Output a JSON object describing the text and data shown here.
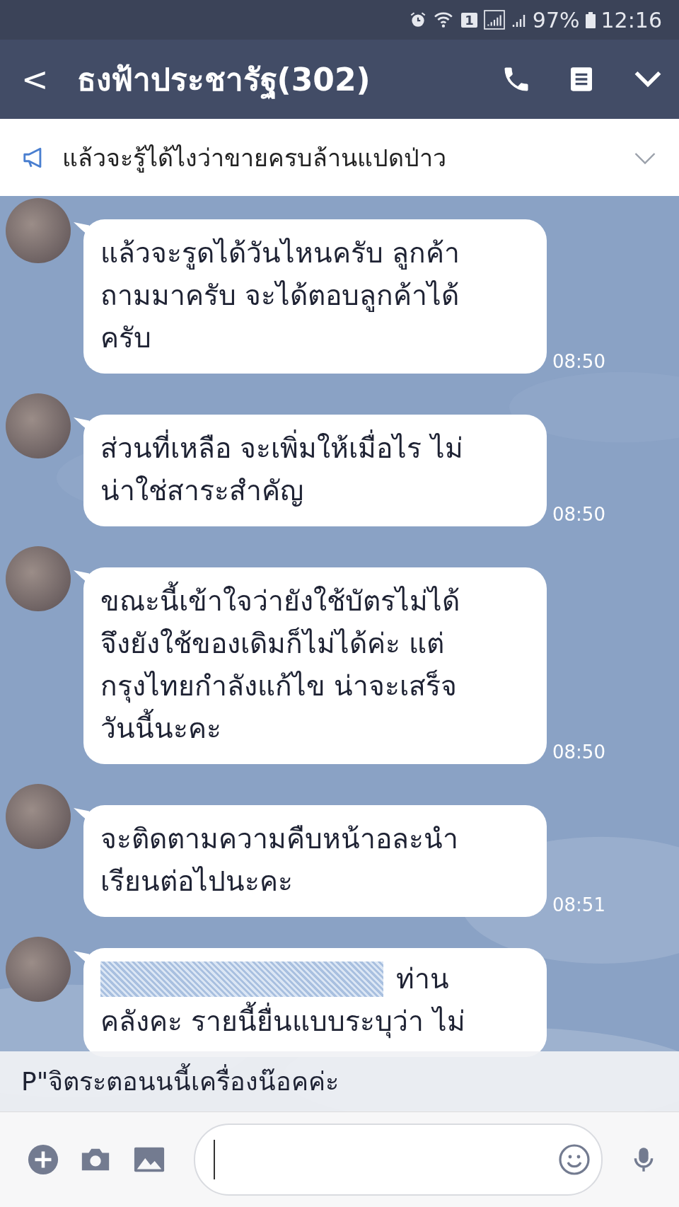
{
  "status_bar": {
    "sim_slot": "1",
    "battery": "97%",
    "time": "12:16"
  },
  "header": {
    "back": "<",
    "title": "ธงฟ้าประชารัฐ(302)"
  },
  "announcement": {
    "text": "แล้วจะรู้ได้ไงว่าขายครบล้านแปดป่าว"
  },
  "messages": [
    {
      "lines": [
        "แล้วจะรูดได้วันไหนครับ ลูกค้า",
        "ถามมาครับ จะได้ตอบลูกค้าได้",
        "ครับ"
      ],
      "time": "08:50",
      "mention": false
    },
    {
      "lines": [
        "ส่วนที่เหลือ จะเพิ่มให้เมื่อไร ไม่",
        "น่าใช่สาระสำคัญ"
      ],
      "time": "08:50",
      "mention": false
    },
    {
      "lines": [
        "ขณะนี้เข้าใจว่ายังใช้บัตรไม่ได้",
        "จึงยังใช้ของเดิมก็ไม่ได้ค่ะ แต่",
        "กรุงไทยกำลังแก้ไข น่าจะเสร็จ",
        "วันนี้นะคะ"
      ],
      "time": "08:50",
      "mention": false
    },
    {
      "lines": [
        "จะติดตามความคืบหน้าอละนำ",
        "เรียนต่อไปนะคะ"
      ],
      "time": "08:51",
      "mention": false
    },
    {
      "lines": [
        "ท่าน",
        "คลังคะ รายนี้ยื่นแบบระบุว่า ไม่"
      ],
      "mention": true
    }
  ],
  "notification": {
    "text": "P\"จิตระตอนนนี้เครื่องน๊อคค่ะ"
  }
}
